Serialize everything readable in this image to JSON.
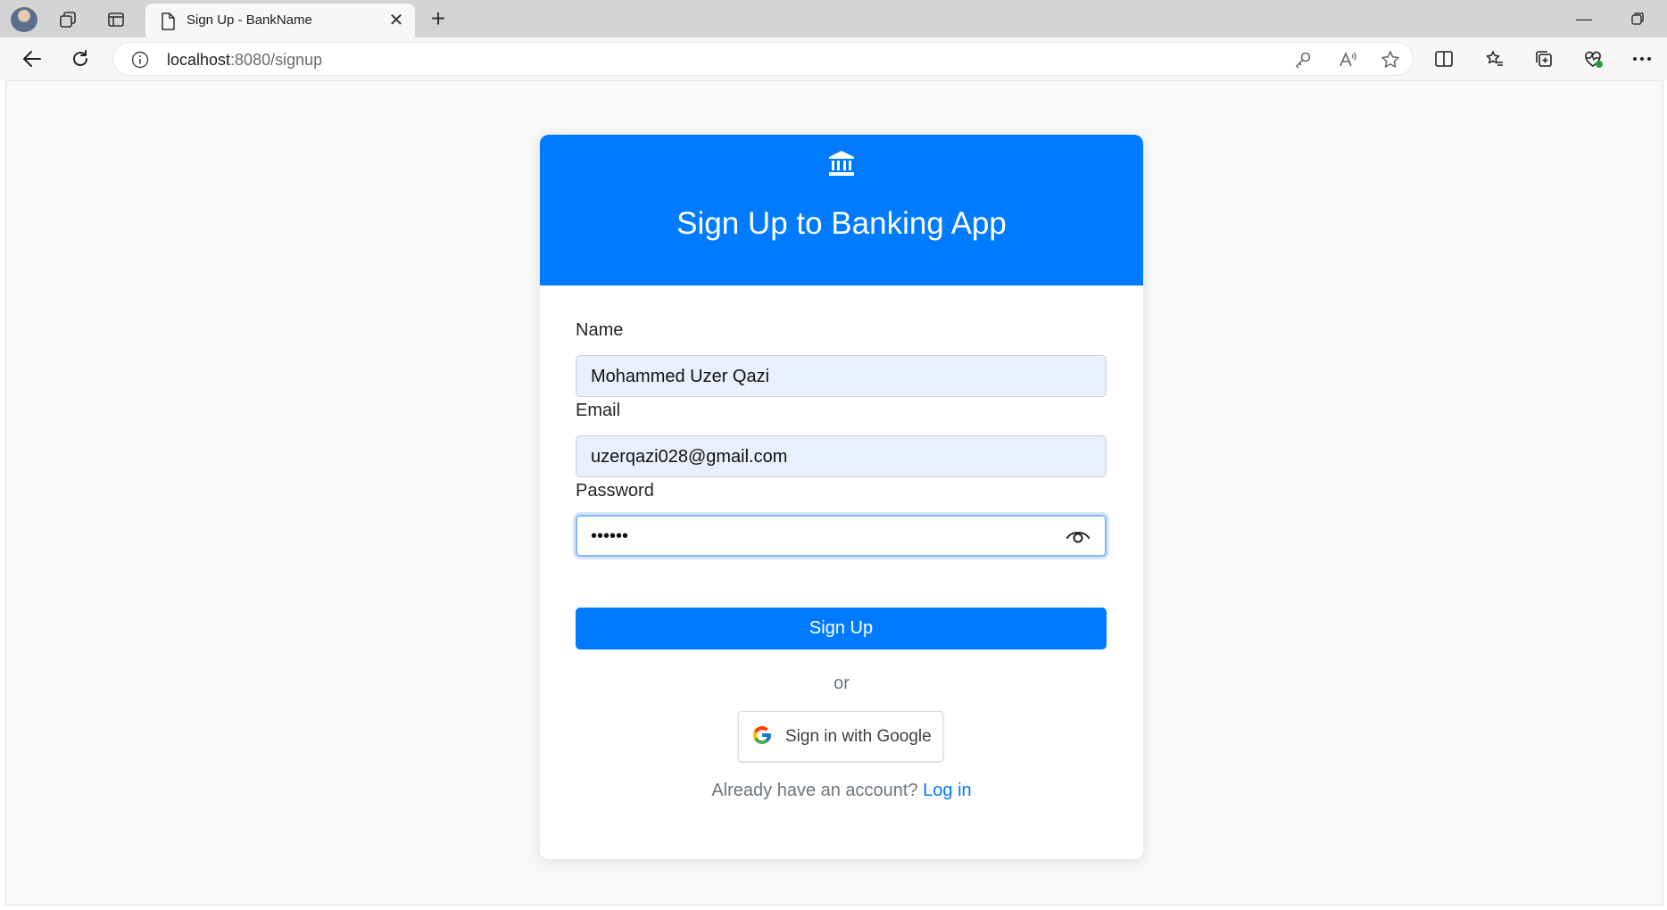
{
  "browser": {
    "tab_title": "Sign Up - BankName",
    "url_host": "localhost",
    "url_rest": ":8080/signup"
  },
  "card": {
    "title": "Sign Up to Banking App",
    "header_color": "#007bff"
  },
  "form": {
    "name_label": "Name",
    "name_value": "Mohammed Uzer Qazi",
    "email_label": "Email",
    "email_value": "uzerqazi028@gmail.com",
    "password_label": "Password",
    "password_value": "••••••",
    "submit_label": "Sign Up",
    "or_text": "or",
    "google_label": "Sign in with Google",
    "login_prompt": "Already have an account?",
    "login_link": "Log in"
  }
}
